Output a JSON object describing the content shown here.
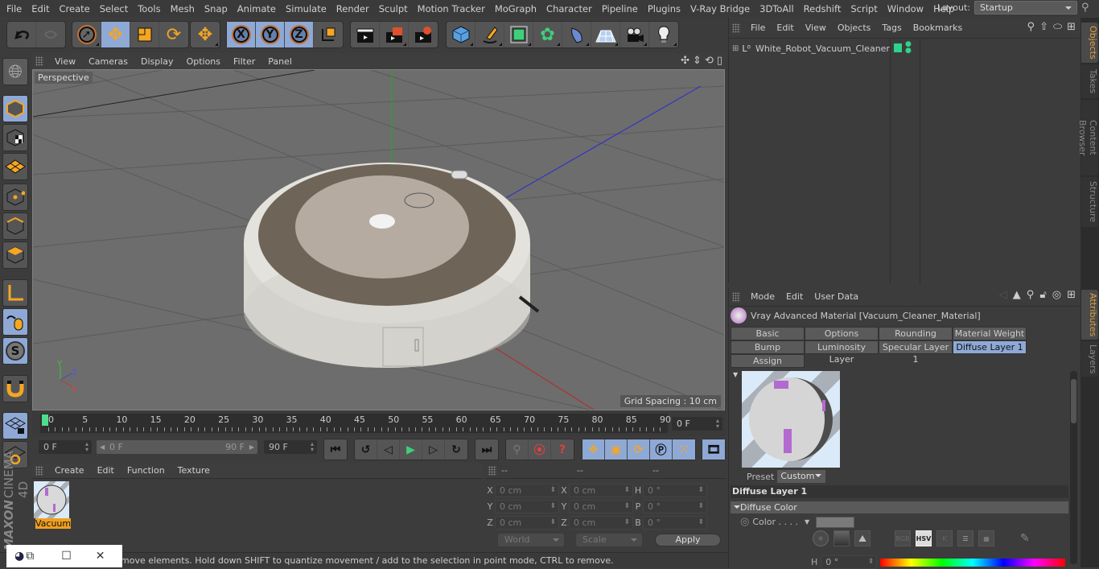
{
  "menubar": {
    "items": [
      "File",
      "Edit",
      "Create",
      "Select",
      "Tools",
      "Mesh",
      "Snap",
      "Animate",
      "Simulate",
      "Render",
      "Sculpt",
      "Motion Tracker",
      "MoGraph",
      "Character",
      "Pipeline",
      "Plugins",
      "V-Ray Bridge",
      "3DToAll",
      "Redshift",
      "Script",
      "Window",
      "Help"
    ],
    "layout_label": "Layout:",
    "layout_value": "Startup"
  },
  "toolbar": {
    "axis_x": "X",
    "axis_y": "Y",
    "axis_z": "Z"
  },
  "viewport": {
    "menu": [
      "View",
      "Cameras",
      "Display",
      "Options",
      "Filter",
      "Panel"
    ],
    "camera_label": "Perspective",
    "grid_spacing": "Grid Spacing : 10 cm",
    "axis_labels": {
      "x": "X",
      "y": "Y",
      "z": "Z"
    }
  },
  "timeline": {
    "ticks": [
      "0",
      "5",
      "10",
      "15",
      "20",
      "25",
      "30",
      "35",
      "40",
      "45",
      "50",
      "55",
      "60",
      "65",
      "70",
      "75",
      "80",
      "85",
      "90"
    ],
    "current_frame": "0 F",
    "start_field": "0 F",
    "range_start": "0 F",
    "range_end": "90 F",
    "end_field": "90 F",
    "playhead_color": "#4fdc8c"
  },
  "material_manager": {
    "menu": [
      "Create",
      "Edit",
      "Function",
      "Texture"
    ],
    "materials": [
      {
        "name": "Vacuum",
        "selected": true
      }
    ]
  },
  "coordinates": {
    "headers": [
      "--",
      "--",
      "--"
    ],
    "rows": [
      {
        "l1": "X",
        "v1": "0 cm",
        "l2": "X",
        "v2": "0 cm",
        "l3": "H",
        "v3": "0 °"
      },
      {
        "l1": "Y",
        "v1": "0 cm",
        "l2": "Y",
        "v2": "0 cm",
        "l3": "P",
        "v3": "0 °"
      },
      {
        "l1": "Z",
        "v1": "0 cm",
        "l2": "Z",
        "v2": "0 cm",
        "l3": "B",
        "v3": "0 °"
      }
    ],
    "space_dropdown": "World",
    "mode_dropdown": "Scale",
    "apply_label": "Apply"
  },
  "status_bar": {
    "text": "move elements. Hold down SHIFT to quantize movement / add to the selection in point mode, CTRL to remove."
  },
  "object_manager": {
    "menu": [
      "File",
      "Edit",
      "View",
      "Objects",
      "Tags",
      "Bookmarks"
    ],
    "objects": [
      {
        "name": "White_Robot_Vacuum_Cleaner",
        "tag_color": "#2ed38a"
      }
    ]
  },
  "attributes": {
    "menu": [
      "Mode",
      "Edit",
      "User Data"
    ],
    "title": "Vray Advanced Material [Vacuum_Cleaner_Material]",
    "tabs": [
      [
        "Basic",
        "Options",
        "Rounding",
        "Material Weight"
      ],
      [
        "Bump",
        "Luminosity Layer",
        "Specular Layer 1",
        "Diffuse Layer 1"
      ],
      [
        "Assign"
      ]
    ],
    "active_tab": "Diffuse Layer 1",
    "preset_label": "Preset",
    "preset_value": "Custom",
    "section_title": "Diffuse Layer 1",
    "group_title": "Diffuse Color",
    "color_label": "Color . . . .",
    "color_value": "#7a7a7a",
    "color_modes": [
      "RGB",
      "HSV",
      "K"
    ],
    "active_color_mode": "HSV",
    "h_label": "H",
    "h_value": "0 °"
  },
  "side_tabs": {
    "top": [
      "Objects",
      "Takes",
      "Content Browser",
      "Structure"
    ],
    "bottom": [
      "Attributes",
      "Layers"
    ],
    "active_top": "Objects",
    "active_bottom": "Attributes"
  },
  "branding": {
    "maxon": "MAXON",
    "product": "CINEMA 4D"
  },
  "accent_color": "#8ea9d6",
  "highlight_color": "#f0a020"
}
